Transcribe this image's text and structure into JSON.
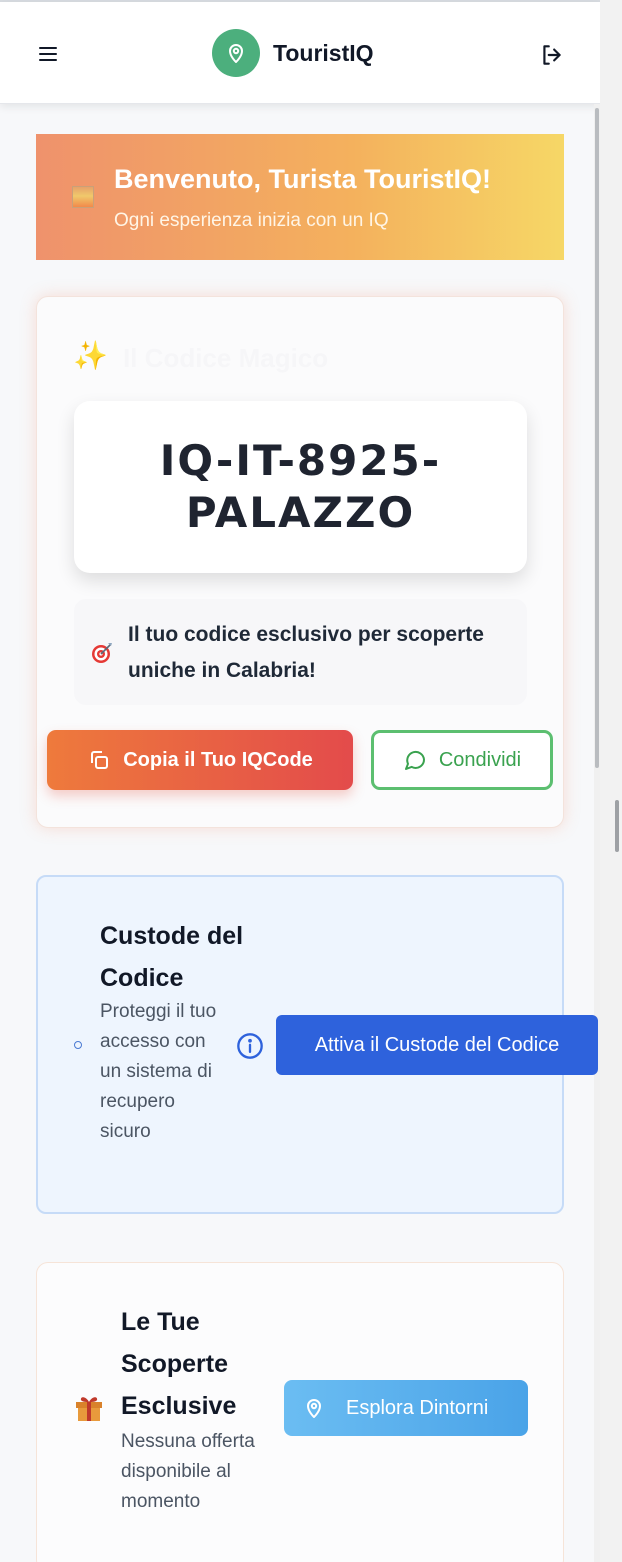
{
  "header": {
    "app_name": "TouristIQ",
    "menu_icon": "hamburger-menu-icon",
    "logo_icon": "map-pin-icon",
    "logout_icon": "logout-icon"
  },
  "welcome": {
    "icon": "sunset-image-icon",
    "title": "Benvenuto, Turista TouristIQ!",
    "subtitle": "Ogni esperienza inizia con un IQ"
  },
  "code_card": {
    "icon": "sparkles-icon",
    "faint_title": "Il Codice Magico",
    "code": "IQ-IT-8925-PALAZZO",
    "exclusive_icon": "target-icon",
    "exclusive_text": "Il tuo codice esclusivo per scoperte uniche in Calabria!",
    "copy_label": "Copia il Tuo IQCode",
    "share_label": "Condividi"
  },
  "custode": {
    "title": "Custode del Codice",
    "description": "Proteggi il tuo accesso con un sistema di recupero sicuro",
    "button_label": "Attiva il Custode del Codice",
    "info_icon": "info-icon"
  },
  "discoveries": {
    "icon": "gift-icon",
    "title": "Le Tue Scoperte Esclusive",
    "description": "Nessuna offerta disponibile al momento",
    "button_label": "Esplora Dintorni"
  },
  "colors": {
    "brand_green": "#4caf7d",
    "accent_blue": "#2e62dc",
    "copy_gradient_start": "#ee7a3c",
    "copy_gradient_end": "#e34b4b",
    "share_green": "#5cbf70"
  }
}
